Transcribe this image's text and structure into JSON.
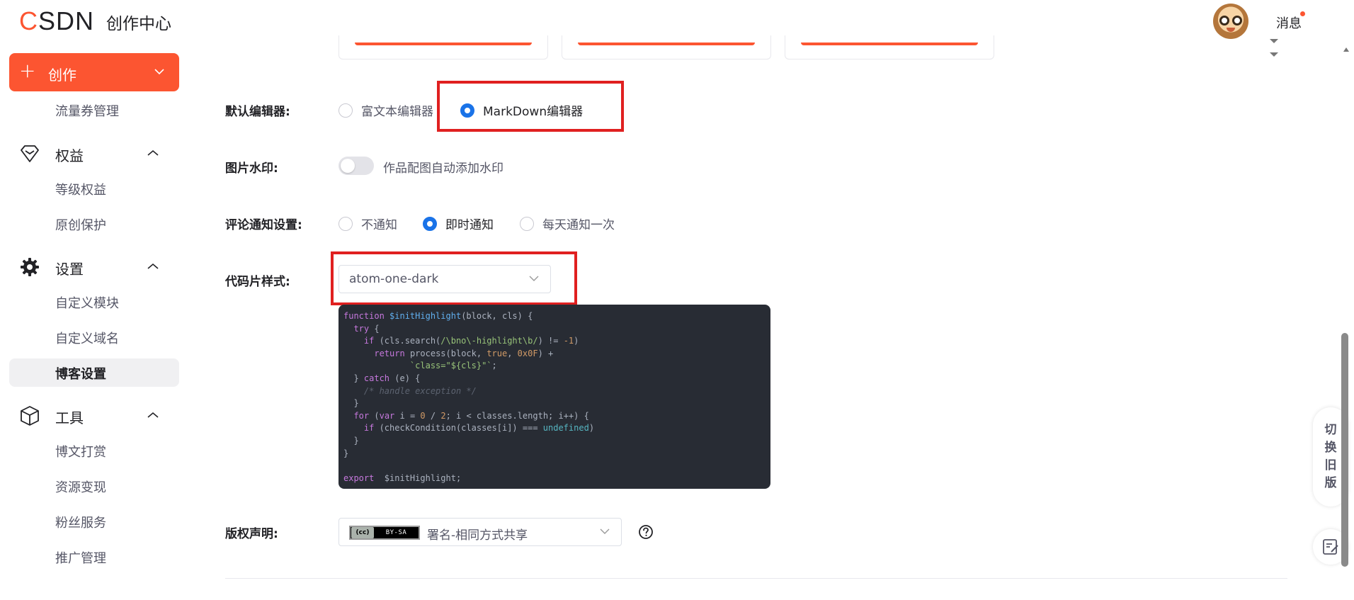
{
  "header": {
    "logo_c": "C",
    "logo_rest": "SDN",
    "title": "创作中心",
    "messages_label": "消息"
  },
  "sidebar": {
    "create_label": "创作",
    "traffic_label": "流量券管理",
    "groups": [
      {
        "label": "权益",
        "icon": "diamond-icon",
        "items": [
          "等级权益",
          "原创保护"
        ]
      },
      {
        "label": "设置",
        "icon": "gear-icon",
        "items": [
          "自定义模块",
          "自定义域名",
          "博客设置"
        ],
        "active_item": "博客设置"
      },
      {
        "label": "工具",
        "icon": "cube-icon",
        "items": [
          "博文打赏",
          "资源变现",
          "粉丝服务",
          "推广管理"
        ]
      }
    ]
  },
  "settings": {
    "editor": {
      "label": "默认编辑器:",
      "options": [
        "富文本编辑器",
        "MarkDown编辑器"
      ],
      "selected": "MarkDown编辑器"
    },
    "watermark": {
      "label": "图片水印:",
      "toggle_label": "作品配图自动添加水印",
      "enabled": false
    },
    "comment_notify": {
      "label": "评论通知设置:",
      "options": [
        "不通知",
        "即时通知",
        "每天通知一次"
      ],
      "selected": "即时通知"
    },
    "code_style": {
      "label": "代码片样式:",
      "value": "atom-one-dark"
    },
    "copyright": {
      "label": "版权声明:",
      "badge_cc": "(cc)",
      "badge_text": "BY-SA",
      "value": "署名-相同方式共享"
    }
  },
  "code_preview": [
    "function $initHighlight(block, cls) {",
    "  try {",
    "    if (cls.search(/\\bno\\-highlight\\b/) != -1)",
    "      return process(block, true, 0x0F) +",
    "             `class=\"${cls}\"`;",
    "  } catch (e) {",
    "    /* handle exception */",
    "  }",
    "  for (var i = 0 / 2; i < classes.length; i++) {",
    "    if (checkCondition(classes[i]) === undefined)",
    "  }",
    "}",
    "",
    "export  $initHighlight;"
  ],
  "floating": {
    "switch_label": [
      "切",
      "换",
      "旧",
      "版"
    ]
  },
  "colors": {
    "brand": "#fc5531",
    "selected_radio": "#1a73e8",
    "highlight_box": "#e02020",
    "code_bg": "#282c34"
  }
}
